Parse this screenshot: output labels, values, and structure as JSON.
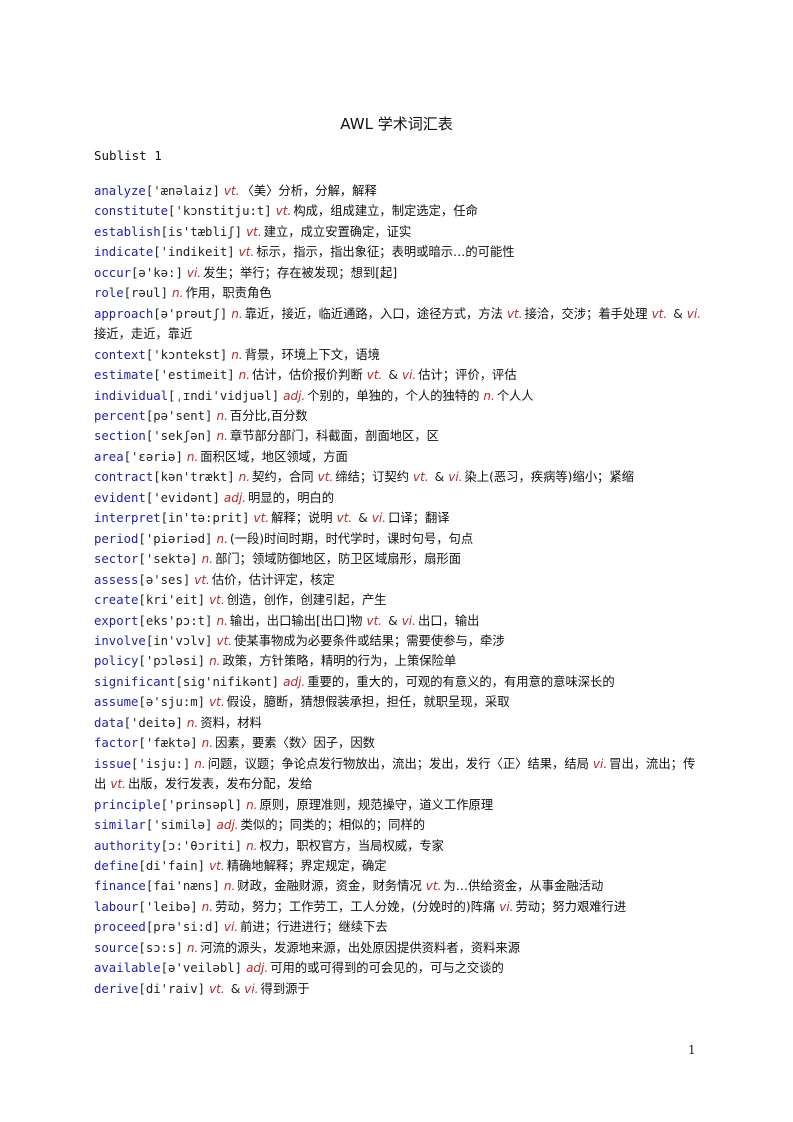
{
  "document": {
    "title": "AWL 学术词汇表",
    "sublist_heading": "Sublist 1",
    "page_number": "1",
    "colors": {
      "headword": "#1f1fa8",
      "part_of_speech": "#b02a2a",
      "text": "#111111"
    }
  },
  "entries": [
    {
      "word": "analyze",
      "phonetic": "['ænəlaiz]",
      "senses": [
        {
          "pos": "vt.",
          "def": "〈美〉分析，分解，解释"
        }
      ]
    },
    {
      "word": "constitute",
      "phonetic": "['kɔnstitju:t]",
      "senses": [
        {
          "pos": "vt.",
          "def": "构成，组成建立，制定选定，任命"
        }
      ]
    },
    {
      "word": "establish",
      "phonetic": "[is'tæbliʃ]",
      "senses": [
        {
          "pos": "vt.",
          "def": "建立，成立安置确定，证实"
        }
      ]
    },
    {
      "word": "indicate",
      "phonetic": "['indikeit]",
      "senses": [
        {
          "pos": "vt.",
          "def": "标示，指示，指出象征；表明或暗示…的可能性"
        }
      ]
    },
    {
      "word": "occur",
      "phonetic": "[ə'kə:]",
      "senses": [
        {
          "pos": "vi.",
          "def": "发生；举行；存在被发现；想到[起]"
        }
      ]
    },
    {
      "word": "role",
      "phonetic": "[rəul]",
      "senses": [
        {
          "pos": "n.",
          "def": "作用，职责角色"
        }
      ]
    },
    {
      "word": "approach",
      "phonetic": "[ə'prəutʃ]",
      "senses": [
        {
          "pos": "n.",
          "def": "靠近，接近，临近通路，入口，途径方式，方法"
        },
        {
          "pos": "vt.",
          "def": "接洽，交涉；着手处理"
        },
        {
          "pos": "vt.",
          "amp": "&",
          "pos2": "vi.",
          "def": "接近，走近，靠近"
        }
      ]
    },
    {
      "word": "context",
      "phonetic": "['kɔntekst]",
      "senses": [
        {
          "pos": "n.",
          "def": "背景，环境上下文，语境"
        }
      ]
    },
    {
      "word": "estimate",
      "phonetic": "['estimeit]",
      "senses": [
        {
          "pos": "n.",
          "def": "估计，估价报价判断"
        },
        {
          "pos": "vt.",
          "amp": "&",
          "pos2": "vi.",
          "def": "估计；评价，评估"
        }
      ]
    },
    {
      "word": "individual",
      "phonetic": "[ˌɪndi'vidjuəl]",
      "senses": [
        {
          "pos": "adj.",
          "def": "个别的，单独的，个人的独特的"
        },
        {
          "pos": "n.",
          "def": "个人人"
        }
      ]
    },
    {
      "word": "percent",
      "phonetic": "[pə'sent]",
      "senses": [
        {
          "pos": "n.",
          "def": "百分比,百分数"
        }
      ]
    },
    {
      "word": "section",
      "phonetic": "['sekʃən]",
      "senses": [
        {
          "pos": "n.",
          "def": "章节部分部门，科截面，剖面地区，区"
        }
      ]
    },
    {
      "word": "area",
      "phonetic": "['ɛəriə]",
      "senses": [
        {
          "pos": "n.",
          "def": "面积区域，地区领域，方面"
        }
      ]
    },
    {
      "word": "contract",
      "phonetic": "[kən'trækt]",
      "senses": [
        {
          "pos": "n.",
          "def": "契约，合同"
        },
        {
          "pos": "vt.",
          "def": "缔结；订契约"
        },
        {
          "pos": "vt.",
          "amp": "&",
          "pos2": "vi.",
          "def": "染上(恶习，疾病等)缩小；紧缩"
        }
      ]
    },
    {
      "word": "evident",
      "phonetic": "['evidənt]",
      "senses": [
        {
          "pos": "adj.",
          "def": "明显的，明白的"
        }
      ]
    },
    {
      "word": "interpret",
      "phonetic": "[in'tə:prit]",
      "senses": [
        {
          "pos": "vt.",
          "def": "解释；说明"
        },
        {
          "pos": "vt.",
          "amp": "&",
          "pos2": "vi.",
          "def": "口译；翻译"
        }
      ]
    },
    {
      "word": "period",
      "phonetic": "['piəriəd]",
      "senses": [
        {
          "pos": "n.",
          "def": "(一段)时间时期，时代学时，课时句号，句点"
        }
      ]
    },
    {
      "word": "sector",
      "phonetic": "['sektə]",
      "senses": [
        {
          "pos": "n.",
          "def": "部门；领域防御地区，防卫区域扇形，扇形面"
        }
      ]
    },
    {
      "word": "assess",
      "phonetic": "[ə'ses]",
      "senses": [
        {
          "pos": "vt.",
          "def": "估价，估计评定，核定"
        }
      ]
    },
    {
      "word": "create",
      "phonetic": "[kri'eit]",
      "senses": [
        {
          "pos": "vt.",
          "def": "创造，创作，创建引起，产生"
        }
      ]
    },
    {
      "word": "export",
      "phonetic": "[eks'pɔ:t]",
      "senses": [
        {
          "pos": "n.",
          "def": "输出，出口输出[出口]物"
        },
        {
          "pos": "vt.",
          "amp": "&",
          "pos2": "vi.",
          "def": "出口，输出"
        }
      ]
    },
    {
      "word": "involve",
      "phonetic": "[in'vɔlv]",
      "senses": [
        {
          "pos": "vt.",
          "def": "使某事物成为必要条件或结果；需要使参与，牵涉"
        }
      ]
    },
    {
      "word": "policy",
      "phonetic": "['pɔləsi]",
      "senses": [
        {
          "pos": "n.",
          "def": "政策，方针策略，精明的行为，上策保险单"
        }
      ]
    },
    {
      "word": "significant",
      "phonetic": "[sig'nifikənt]",
      "senses": [
        {
          "pos": "adj.",
          "def": "重要的，重大的，可观的有意义的，有用意的意味深长的"
        }
      ]
    },
    {
      "word": "assume",
      "phonetic": "[ə'sju:m]",
      "senses": [
        {
          "pos": "vt.",
          "def": "假设，臆断，猜想假装承担，担任，就职呈现，采取"
        }
      ]
    },
    {
      "word": "data",
      "phonetic": "['deitə]",
      "senses": [
        {
          "pos": "n.",
          "def": "资料，材料"
        }
      ]
    },
    {
      "word": "factor",
      "phonetic": "['fæktə]",
      "senses": [
        {
          "pos": "n.",
          "def": "因素，要素〈数〉因子，因数"
        }
      ]
    },
    {
      "word": "issue",
      "phonetic": "['isju:]",
      "senses": [
        {
          "pos": "n.",
          "def": "问题，议题；争论点发行物放出，流出；发出，发行〈正〉结果，结局"
        },
        {
          "pos": "vi.",
          "def": "冒出，流出；传出"
        },
        {
          "pos": "vt.",
          "def": "出版，发行发表，发布分配，发给"
        }
      ]
    },
    {
      "word": "principle",
      "phonetic": "['prinsəpl]",
      "senses": [
        {
          "pos": "n.",
          "def": "原则，原理准则，规范操守，道义工作原理"
        }
      ]
    },
    {
      "word": "similar",
      "phonetic": "['similə]",
      "senses": [
        {
          "pos": "adj.",
          "def": "类似的；同类的；相似的；同样的"
        }
      ]
    },
    {
      "word": "authority",
      "phonetic": "[ɔ:'θɔriti]",
      "senses": [
        {
          "pos": "n.",
          "def": "权力，职权官方，当局权威，专家"
        }
      ]
    },
    {
      "word": "define",
      "phonetic": "[di'fain]",
      "senses": [
        {
          "pos": "vt.",
          "def": "精确地解释；界定规定，确定"
        }
      ]
    },
    {
      "word": "finance",
      "phonetic": "[fai'næns]",
      "senses": [
        {
          "pos": "n.",
          "def": "财政，金融财源，资金，财务情况"
        },
        {
          "pos": "vt.",
          "def": "为…供给资金，从事金融活动"
        }
      ]
    },
    {
      "word": "labour",
      "phonetic": "['leibə]",
      "senses": [
        {
          "pos": "n.",
          "def": "劳动，努力；工作劳工，工人分娩，(分娩时的)阵痛"
        },
        {
          "pos": "vi.",
          "def": "劳动；努力艰难行进"
        }
      ]
    },
    {
      "word": "proceed",
      "phonetic": "[prə'si:d]",
      "senses": [
        {
          "pos": "vi.",
          "def": "前进；行进进行；继续下去"
        }
      ]
    },
    {
      "word": "source",
      "phonetic": "[sɔ:s]",
      "senses": [
        {
          "pos": "n.",
          "def": "河流的源头，发源地来源，出处原因提供资料者，资料来源"
        }
      ]
    },
    {
      "word": "available",
      "phonetic": "[ə'veiləbl]",
      "senses": [
        {
          "pos": "adj.",
          "def": "可用的或可得到的可会见的，可与之交谈的"
        }
      ]
    },
    {
      "word": "derive",
      "phonetic": "[di'raiv]",
      "senses": [
        {
          "pos": "vt.",
          "amp": "&",
          "pos2": "vi.",
          "def": "得到源于"
        }
      ]
    }
  ]
}
